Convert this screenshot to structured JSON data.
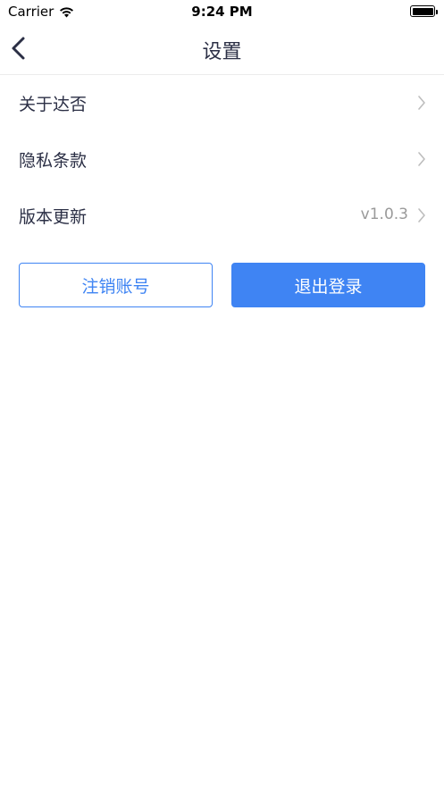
{
  "status_bar": {
    "carrier": "Carrier",
    "time": "9:24 PM"
  },
  "nav": {
    "title": "设置"
  },
  "menu": {
    "items": [
      {
        "label": "关于达否",
        "value": ""
      },
      {
        "label": "隐私条款",
        "value": ""
      },
      {
        "label": "版本更新",
        "value": "v1.0.3"
      }
    ]
  },
  "actions": {
    "deactivate_label": "注销账号",
    "logout_label": "退出登录"
  },
  "colors": {
    "accent": "#3f84f3",
    "text": "#2b2f45",
    "secondary": "#9a9a9a"
  }
}
